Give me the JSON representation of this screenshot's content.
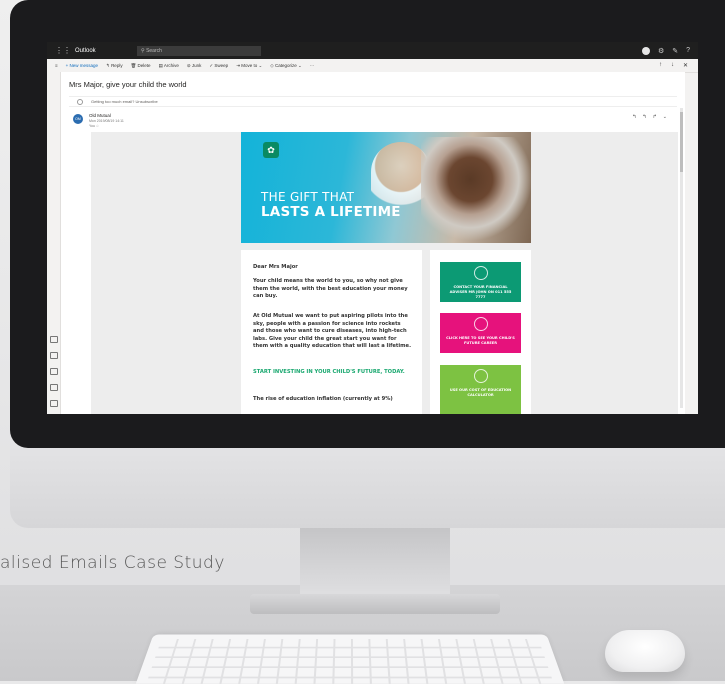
{
  "caption": "alised Emails Case Study",
  "outlook": {
    "app_name": "Outlook",
    "search_placeholder": "Search",
    "commands": [
      "+ New message",
      "Reply",
      "Delete",
      "Archive",
      "Junk",
      "Sweep",
      "Move to",
      "Categorize",
      "···"
    ],
    "subject": "Mrs Major, give your child the world",
    "preview_text": "Getting too much email? Unsubscribe",
    "sender": {
      "initials": "OM",
      "name": "Old Mutual",
      "date": "Mon 2019/08/19 14:11",
      "to": "You ☆"
    }
  },
  "email": {
    "hero_line1": "THE GIFT THAT",
    "hero_line2": "LASTS A LIFETIME",
    "greeting": "Dear Mrs Major",
    "para1": "Your child means the world to you, so why not give them the world, with the best education your money can buy.",
    "para2": "At Old Mutual we want to put aspiring pilots into the sky, people with a passion for science into rockets and those who want to cure diseases, into high-tech labs. Give your child the great start you want for them with a quality education that will last a lifetime.",
    "cta": "START INVESTING IN YOUR CHILD'S FUTURE, TODAY.",
    "para3": "The rise of education inflation (currently at 9%)",
    "cards": [
      {
        "label": "CONTACT YOUR FINANCIAL ADVISER MR JOHN ON 011 555 7777",
        "color": "#0c9a74"
      },
      {
        "label": "CLICK HERE TO SEE YOUR CHILD'S FUTURE CAREER",
        "color": "#e6127c"
      },
      {
        "label": "USE OUR COST OF EDUCATION CALCULATOR",
        "color": "#7dc242"
      }
    ]
  }
}
